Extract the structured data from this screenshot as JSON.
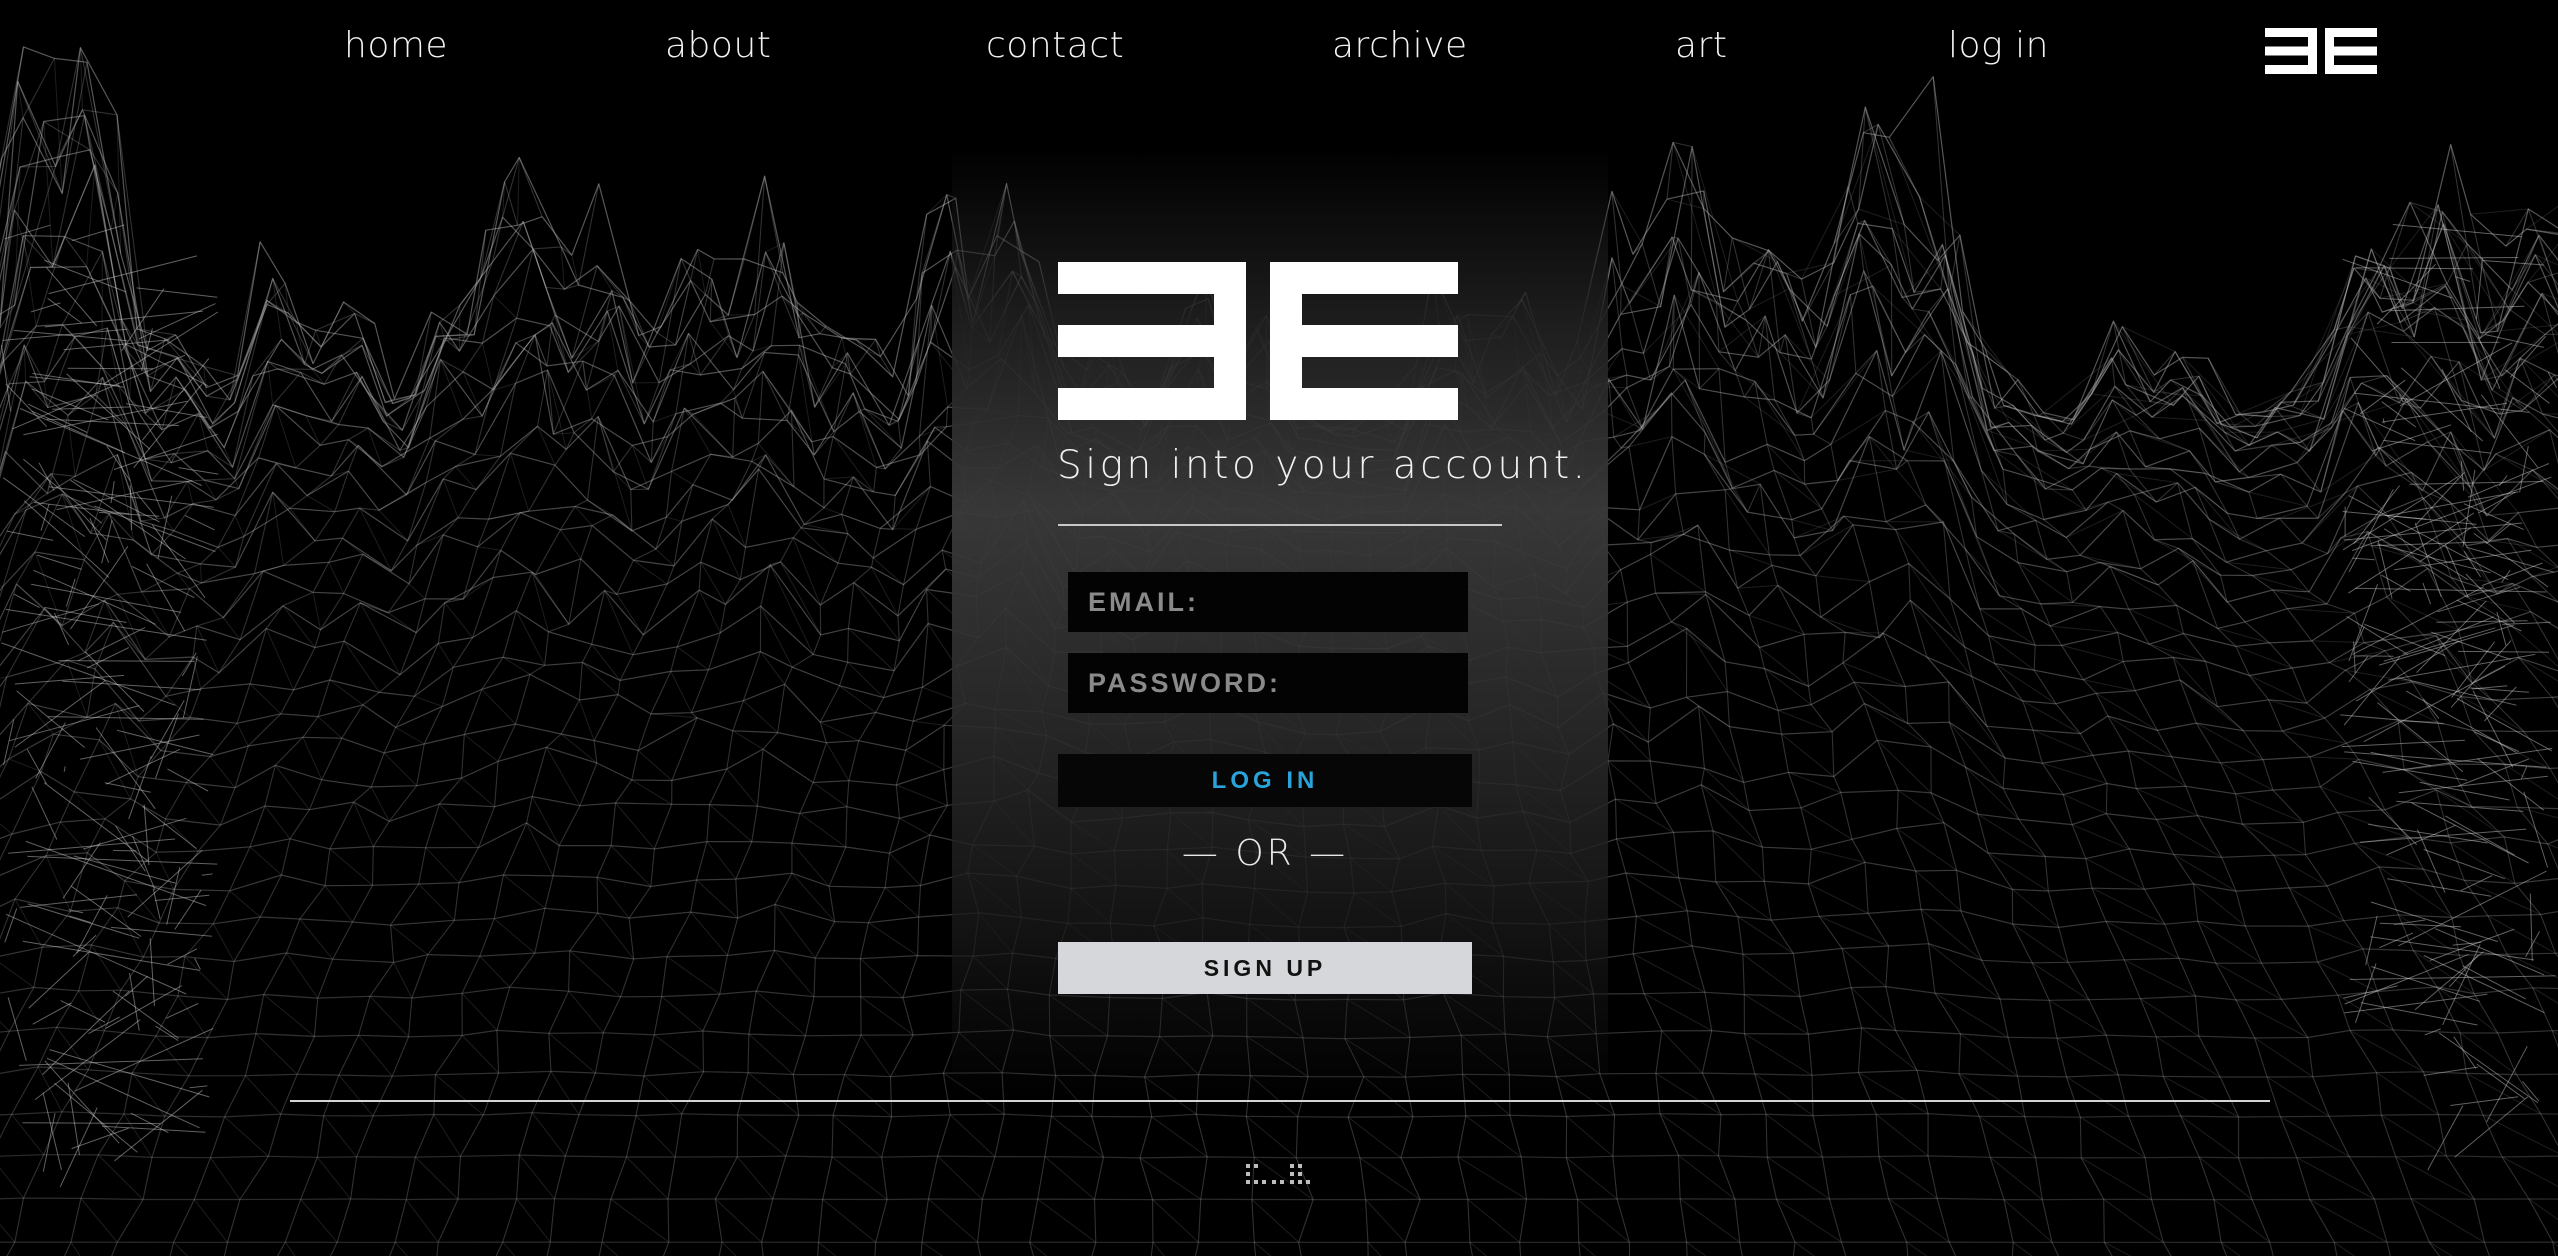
{
  "nav": {
    "items": [
      {
        "label": "home"
      },
      {
        "label": "about"
      },
      {
        "label": "contact"
      },
      {
        "label": "archive"
      },
      {
        "label": "art"
      },
      {
        "label": "log in"
      }
    ],
    "logo_icon": "3e-logo-icon"
  },
  "login": {
    "logo_icon": "3e-logo-icon",
    "heading": "Sign into your account.",
    "email_placeholder": "EMAIL:",
    "password_placeholder": "PASSWORD:",
    "login_label": "LOG IN",
    "or_label": "— OR —",
    "signup_label": "SIGN UP"
  },
  "footer": {
    "mark_icon": "dotted-mark-icon"
  },
  "colors": {
    "background": "#000000",
    "accent": "#29a3d9",
    "signup_button": "#d6d7da",
    "text": "#f0f0f0"
  }
}
